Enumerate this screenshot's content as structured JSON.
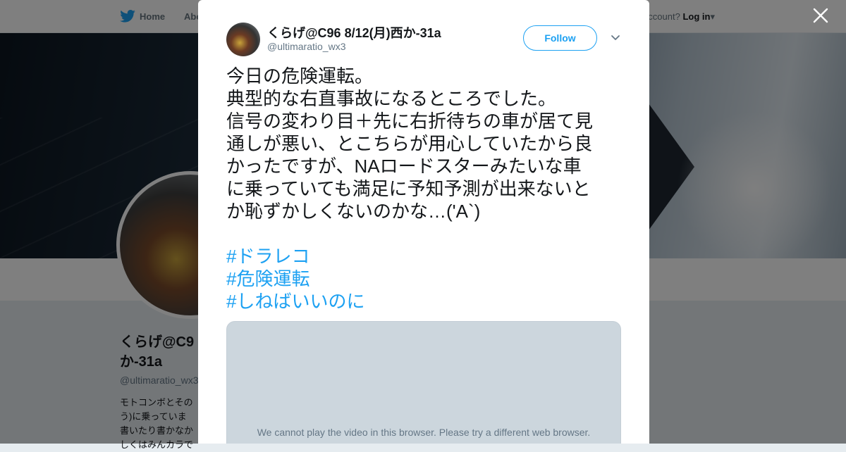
{
  "topnav": {
    "home_label": "Home",
    "about_label": "Abo",
    "account_prompt": "account?",
    "login_label": "Log in"
  },
  "profile": {
    "name_line1": "くらげ@C9",
    "name_line2": "か-31a",
    "handle": "@ultimaratio_wx3",
    "bio_line1": "モトコンボとその",
    "bio_line2": "う)に乗っていま",
    "bio_line3": "書いたり書かなか",
    "bio_line4": "しくはみんカラで"
  },
  "tweet": {
    "author_name": "くらげ@C96 8/12(月)西か-31a",
    "author_handle": "@ultimaratio_wx3",
    "follow_label": "Follow",
    "lines": [
      "今日の危険運転。",
      "典型的な右直事故になるところでした。",
      "信号の変わり目＋先に右折待ちの車が居て見",
      "通しが悪い、とこちらが用心していたから良",
      "かったですが、NAロードスターみたいな車",
      "に乗っていても満足に予知予測が出来ないと",
      "か恥ずかしくないのかな…('A`)"
    ],
    "hashtags": [
      "#ドラレコ",
      "#危険運転",
      "#しねばいいのに"
    ],
    "video_message": "We cannot play the video in this browser. Please try a different web browser."
  },
  "colors": {
    "accent": "#1da1f2",
    "text": "#14171a",
    "muted": "#657786",
    "video_bg": "#ccd6dd"
  },
  "icons": {
    "logo": "twitter-bird-icon",
    "close": "close-icon",
    "caret": "chevron-down-icon"
  }
}
